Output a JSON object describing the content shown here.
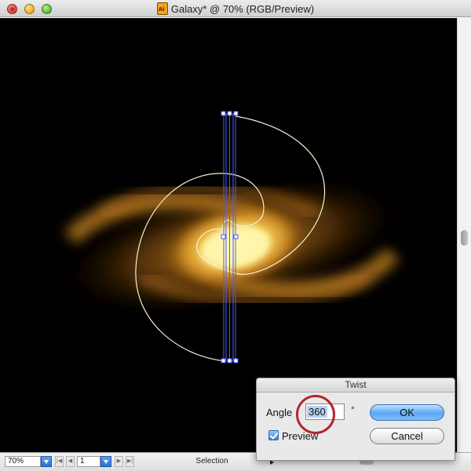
{
  "window": {
    "title": "Galaxy* @ 70% (RGB/Preview)",
    "app_icon_label": "Ai"
  },
  "status_bar": {
    "zoom": "70%",
    "artboard": "1",
    "status": "Selection"
  },
  "dialog": {
    "title": "Twist",
    "angle_label": "Angle",
    "angle_value": "360",
    "degree_symbol": "°",
    "preview_label": "Preview",
    "preview_checked": true,
    "ok_label": "OK",
    "cancel_label": "Cancel"
  },
  "colors": {
    "canvas": "#000000",
    "path": "#f4f1d0",
    "selection": "#4a5cff",
    "annotation": "#b0262b",
    "galaxy_core": "#fff6a0",
    "galaxy_arm": "#c8781a"
  },
  "icons": [
    "close-icon",
    "minimize-icon",
    "zoom-icon",
    "illustrator-document-icon",
    "checkbox-icon",
    "dropdown-arrow-icon",
    "nav-first-icon",
    "nav-prev-icon",
    "nav-next-icon",
    "nav-last-icon",
    "disclosure-triangle-icon"
  ]
}
